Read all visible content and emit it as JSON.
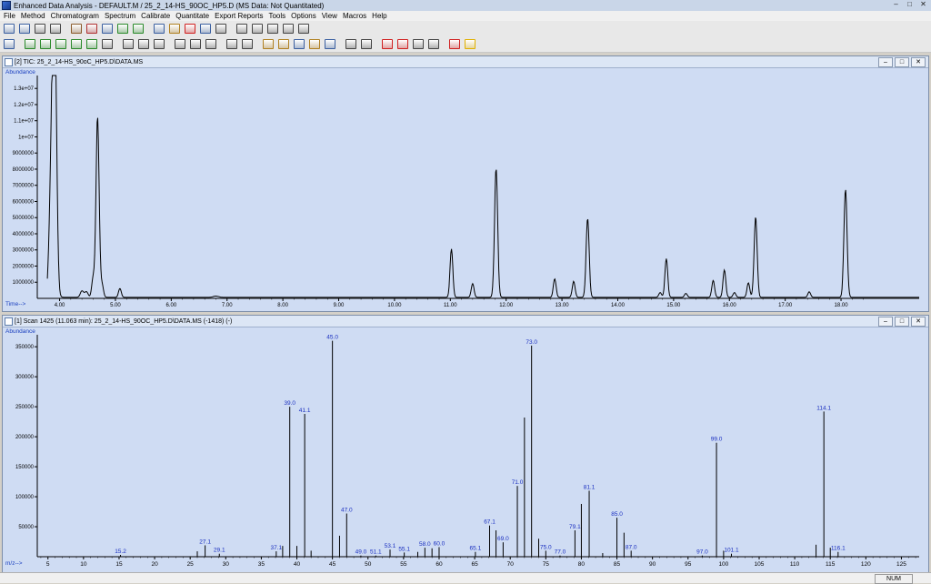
{
  "window": {
    "title": "Enhanced Data Analysis - DEFAULT.M / 25_2_14-HS_90OC_HP5.D   (MS Data: Not Quantitated)",
    "controls": [
      "–",
      "□",
      "✕"
    ]
  },
  "menu": [
    "File",
    "Method",
    "Chromatogram",
    "Spectrum",
    "Calibrate",
    "Quantitate",
    "Export Reports",
    "Tools",
    "Options",
    "View",
    "Macros",
    "Help"
  ],
  "toolbar1": [
    {
      "icon": "integrate-icon",
      "color": "#3a5fa0"
    },
    {
      "icon": "library-search-icon",
      "color": "#3a5fa0"
    },
    {
      "icon": "camera-icon",
      "color": "#444444"
    },
    {
      "icon": "print-icon",
      "color": "#444444"
    },
    {
      "sep": true
    },
    {
      "icon": "load-file-icon",
      "color": "#8a5a2a"
    },
    {
      "icon": "report-icon",
      "color": "#b03030"
    },
    {
      "icon": "copy-data-icon",
      "color": "#3a5fa0"
    },
    {
      "icon": "chart-icon",
      "color": "#2a8a2a"
    },
    {
      "icon": "chart-green-icon",
      "color": "#2a8a2a"
    },
    {
      "sep": true
    },
    {
      "icon": "copy-icon",
      "color": "#3a5fa0"
    },
    {
      "icon": "paste-icon",
      "color": "#b08020"
    },
    {
      "icon": "color-grid-icon",
      "color": "#d02020"
    },
    {
      "icon": "window-icon",
      "color": "#3a5fa0"
    },
    {
      "icon": "settings-icon",
      "color": "#444444"
    },
    {
      "sep": true
    },
    {
      "icon": "hammer-1-icon",
      "color": "#444444"
    },
    {
      "icon": "hammer-2-icon",
      "color": "#444444"
    },
    {
      "icon": "hammer-3-icon",
      "color": "#444444"
    },
    {
      "icon": "hammer-4-icon",
      "color": "#444444"
    },
    {
      "icon": "hammer-5-icon",
      "color": "#444444"
    }
  ],
  "toolbar2": [
    {
      "icon": "target-icon",
      "color": "#3a5fa0"
    },
    {
      "sep": true
    },
    {
      "icon": "chromatogram-1-icon",
      "color": "#2a8a2a"
    },
    {
      "icon": "chromatogram-2-icon",
      "color": "#2a8a2a"
    },
    {
      "icon": "chromatogram-3-icon",
      "color": "#2a8a2a"
    },
    {
      "icon": "chromatogram-4-icon",
      "color": "#2a8a2a"
    },
    {
      "icon": "chromatogram-5-icon",
      "color": "#2a8a2a"
    },
    {
      "icon": "check-icon",
      "color": "#444444"
    },
    {
      "sep": true
    },
    {
      "icon": "spectrum-icon",
      "color": "#444444"
    },
    {
      "icon": "peak-icon",
      "color": "#444444"
    },
    {
      "icon": "sort-icon",
      "color": "#444444"
    },
    {
      "sep": true
    },
    {
      "icon": "tune-icon",
      "color": "#444444"
    },
    {
      "icon": "bank-icon",
      "color": "#444444"
    },
    {
      "icon": "table-icon",
      "color": "#444444"
    },
    {
      "sep": true
    },
    {
      "icon": "axis-icon",
      "color": "#444444"
    },
    {
      "icon": "axis-zoom-icon",
      "color": "#444444"
    },
    {
      "sep": true
    },
    {
      "icon": "graph-up-icon",
      "color": "#b08020"
    },
    {
      "icon": "graph-icon",
      "color": "#b08020"
    },
    {
      "icon": "copy-graph-icon",
      "color": "#3a5fa0"
    },
    {
      "icon": "paste-graph-icon",
      "color": "#b08020"
    },
    {
      "icon": "export-graph-icon",
      "color": "#3a5fa0"
    },
    {
      "sep": true
    },
    {
      "icon": "doc-icon",
      "color": "#444444"
    },
    {
      "icon": "doc-search-icon",
      "color": "#444444"
    },
    {
      "sep": true
    },
    {
      "icon": "abc-icon",
      "color": "#d02020"
    },
    {
      "icon": "pointer-icon",
      "color": "#d02020"
    },
    {
      "icon": "eraser-icon",
      "color": "#444444"
    },
    {
      "icon": "ruler-icon",
      "color": "#444444"
    },
    {
      "sep": true
    },
    {
      "icon": "stop-icon",
      "color": "#d02020"
    },
    {
      "icon": "help-icon",
      "color": "#e0b000"
    }
  ],
  "panels": {
    "tic": {
      "title": "[2] TIC: 25_2_14-HS_90oC_HP5.D\\DATA.MS"
    },
    "scan": {
      "title": "[1] Scan 1425 (11.063 min): 25_2_14-HS_90OC_HP5.D\\DATA.MS (-1418) (-)"
    }
  },
  "status": {
    "num": "NUM"
  },
  "chart_data": [
    {
      "type": "line",
      "y_label": "Abundance",
      "x_label": "Time-->",
      "xlim": [
        3.6,
        19.4
      ],
      "ylim": [
        0,
        13800000
      ],
      "x_ticks": [
        "4.00",
        "5.00",
        "6.00",
        "7.00",
        "8.00",
        "9.00",
        "10.00",
        "11.00",
        "12.00",
        "13.00",
        "14.00",
        "15.00",
        "16.00",
        "17.00",
        "18.00"
      ],
      "y_ticks": [
        {
          "v": 1000000,
          "label": "1000000"
        },
        {
          "v": 2000000,
          "label": "2000000"
        },
        {
          "v": 3000000,
          "label": "3000000"
        },
        {
          "v": 4000000,
          "label": "4000000"
        },
        {
          "v": 5000000,
          "label": "5000000"
        },
        {
          "v": 6000000,
          "label": "6000000"
        },
        {
          "v": 7000000,
          "label": "7000000"
        },
        {
          "v": 8000000,
          "label": "8000000"
        },
        {
          "v": 9000000,
          "label": "9000000"
        },
        {
          "v": 10000000,
          "label": "1e+07"
        },
        {
          "v": 11000000,
          "label": "1.1e+07"
        },
        {
          "v": 12000000,
          "label": "1.2e+07"
        },
        {
          "v": 13000000,
          "label": "1.3e+07"
        }
      ],
      "peaks": [
        {
          "rt": 3.88,
          "h": 13700000,
          "w": 0.045
        },
        {
          "rt": 3.92,
          "h": 9000000,
          "w": 0.03
        },
        {
          "rt": 4.4,
          "h": 400000,
          "w": 0.03
        },
        {
          "rt": 4.48,
          "h": 350000,
          "w": 0.03
        },
        {
          "rt": 4.6,
          "h": 1200000,
          "w": 0.025
        },
        {
          "rt": 4.68,
          "h": 11200000,
          "w": 0.028
        },
        {
          "rt": 4.76,
          "h": 800000,
          "w": 0.025
        },
        {
          "rt": 5.08,
          "h": 550000,
          "w": 0.025
        },
        {
          "rt": 6.8,
          "h": 80000,
          "w": 0.05
        },
        {
          "rt": 11.02,
          "h": 3000000,
          "w": 0.025
        },
        {
          "rt": 11.4,
          "h": 850000,
          "w": 0.025
        },
        {
          "rt": 11.82,
          "h": 8000000,
          "w": 0.028
        },
        {
          "rt": 12.87,
          "h": 1150000,
          "w": 0.025
        },
        {
          "rt": 13.21,
          "h": 1000000,
          "w": 0.025
        },
        {
          "rt": 13.46,
          "h": 4900000,
          "w": 0.027
        },
        {
          "rt": 14.76,
          "h": 300000,
          "w": 0.025
        },
        {
          "rt": 14.87,
          "h": 2400000,
          "w": 0.025
        },
        {
          "rt": 15.22,
          "h": 250000,
          "w": 0.025
        },
        {
          "rt": 15.71,
          "h": 1050000,
          "w": 0.025
        },
        {
          "rt": 15.91,
          "h": 1700000,
          "w": 0.025
        },
        {
          "rt": 16.09,
          "h": 300000,
          "w": 0.025
        },
        {
          "rt": 16.34,
          "h": 900000,
          "w": 0.025
        },
        {
          "rt": 16.47,
          "h": 5000000,
          "w": 0.027
        },
        {
          "rt": 17.43,
          "h": 350000,
          "w": 0.025
        },
        {
          "rt": 18.08,
          "h": 6700000,
          "w": 0.028
        }
      ]
    },
    {
      "type": "bar",
      "y_label": "Abundance",
      "x_label": "m/z-->",
      "xlim": [
        3.5,
        127.5
      ],
      "ylim": [
        0,
        370000
      ],
      "x_ticks": [
        5,
        10,
        15,
        20,
        25,
        30,
        35,
        40,
        45,
        50,
        55,
        60,
        65,
        70,
        75,
        80,
        85,
        90,
        95,
        100,
        105,
        110,
        115,
        120,
        125
      ],
      "y_ticks": [
        50000,
        100000,
        150000,
        200000,
        250000,
        300000,
        350000
      ],
      "bars": [
        {
          "mz": 15.2,
          "ab": 3000,
          "label": "15.2"
        },
        {
          "mz": 26.0,
          "ab": 9000
        },
        {
          "mz": 27.1,
          "ab": 19000,
          "label": "27.1"
        },
        {
          "mz": 29.1,
          "ab": 5000,
          "label": "29.1"
        },
        {
          "mz": 37.1,
          "ab": 9000,
          "label": "37.1"
        },
        {
          "mz": 38.0,
          "ab": 18000
        },
        {
          "mz": 39.0,
          "ab": 250000,
          "label": "39.0"
        },
        {
          "mz": 40.0,
          "ab": 18000
        },
        {
          "mz": 41.1,
          "ab": 238000,
          "label": "41.1"
        },
        {
          "mz": 42.0,
          "ab": 10000
        },
        {
          "mz": 45.0,
          "ab": 360000,
          "label": "45.0"
        },
        {
          "mz": 46.0,
          "ab": 35000
        },
        {
          "mz": 47.0,
          "ab": 72000,
          "label": "47.0"
        },
        {
          "mz": 49.0,
          "ab": 2000,
          "label": "49.0"
        },
        {
          "mz": 51.1,
          "ab": 2000,
          "label": "51.1"
        },
        {
          "mz": 53.1,
          "ab": 12000,
          "label": "53.1"
        },
        {
          "mz": 55.1,
          "ab": 7000,
          "label": "55.1"
        },
        {
          "mz": 57.0,
          "ab": 8000
        },
        {
          "mz": 58.0,
          "ab": 15000,
          "label": "58.0"
        },
        {
          "mz": 59.0,
          "ab": 14000
        },
        {
          "mz": 60.0,
          "ab": 16000,
          "label": "60.0"
        },
        {
          "mz": 65.1,
          "ab": 8000,
          "label": "65.1"
        },
        {
          "mz": 67.1,
          "ab": 52000,
          "label": "67.1"
        },
        {
          "mz": 68.0,
          "ab": 44000
        },
        {
          "mz": 69.0,
          "ab": 24000,
          "label": "69.0"
        },
        {
          "mz": 71.0,
          "ab": 118000,
          "label": "71.0"
        },
        {
          "mz": 72.0,
          "ab": 232000
        },
        {
          "mz": 73.0,
          "ab": 352000,
          "label": "73.0"
        },
        {
          "mz": 74.0,
          "ab": 30000
        },
        {
          "mz": 75.0,
          "ab": 10000,
          "label": "75.0"
        },
        {
          "mz": 77.0,
          "ab": 2000,
          "label": "77.0"
        },
        {
          "mz": 79.1,
          "ab": 44000,
          "label": "79.1"
        },
        {
          "mz": 80.0,
          "ab": 88000
        },
        {
          "mz": 81.1,
          "ab": 110000,
          "label": "81.1"
        },
        {
          "mz": 83.0,
          "ab": 6000
        },
        {
          "mz": 85.0,
          "ab": 65000,
          "label": "85.0"
        },
        {
          "mz": 86.0,
          "ab": 40000
        },
        {
          "mz": 87.0,
          "ab": 10000,
          "label": "87.0"
        },
        {
          "mz": 97.0,
          "ab": 2000,
          "label": "97.0"
        },
        {
          "mz": 99.0,
          "ab": 190000,
          "label": "99.0"
        },
        {
          "mz": 100.0,
          "ab": 10000
        },
        {
          "mz": 101.1,
          "ab": 5000,
          "label": "101.1"
        },
        {
          "mz": 113.0,
          "ab": 20000
        },
        {
          "mz": 114.1,
          "ab": 242000,
          "label": "114.1"
        },
        {
          "mz": 115.0,
          "ab": 15000
        },
        {
          "mz": 116.1,
          "ab": 8000,
          "label": "116.1"
        }
      ]
    }
  ]
}
